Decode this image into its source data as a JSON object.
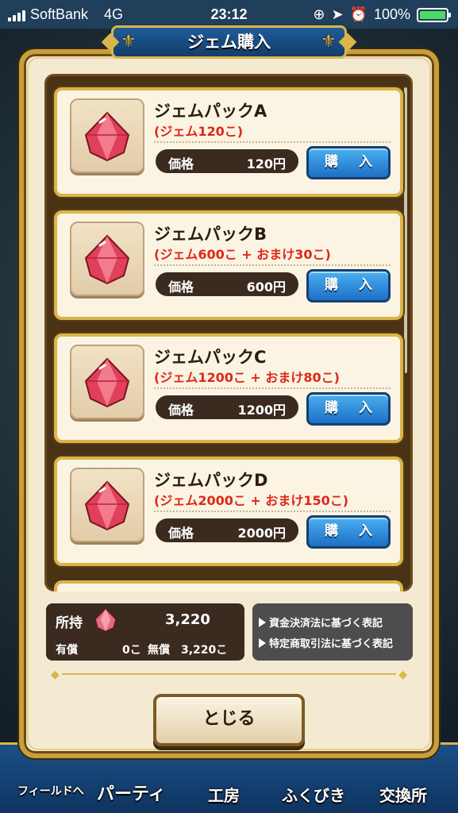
{
  "status": {
    "carrier": "SoftBank",
    "network": "4G",
    "time": "23:12",
    "battery": "100%"
  },
  "dialog": {
    "title": "ジェム購入"
  },
  "packs": [
    {
      "name": "ジェムパックA",
      "bonus": "(ジェム120こ)",
      "price_label": "価格",
      "price": "120円",
      "buy_label": "購 入"
    },
    {
      "name": "ジェムパックB",
      "bonus": "(ジェム600こ + おまけ30こ)",
      "price_label": "価格",
      "price": "600円",
      "buy_label": "購 入"
    },
    {
      "name": "ジェムパックC",
      "bonus": "(ジェム1200こ + おまけ80こ)",
      "price_label": "価格",
      "price": "1200円",
      "buy_label": "購 入"
    },
    {
      "name": "ジェムパックD",
      "bonus": "(ジェム2000こ + おまけ150こ)",
      "price_label": "価格",
      "price": "2000円",
      "buy_label": "購 入"
    }
  ],
  "owned": {
    "label": "所持",
    "total": "3,220",
    "unit": "こ",
    "paid_label": "有償",
    "paid_value": "0こ",
    "free_label": "無償",
    "free_value": "3,220こ"
  },
  "legal": {
    "link1": "資金決済法に基づく表記",
    "link2": "特定商取引法に基づく表記"
  },
  "close_label": "とじる",
  "bottom_nav": {
    "field": "フィールドへ",
    "party": "パーティ",
    "kobo": "工房",
    "fukubiki": "ふくびき",
    "kokan": "交換所"
  },
  "colors": {
    "accent_gold": "#d9b54a",
    "bonus_red": "#e0271b",
    "buy_blue": "#1d6fc6"
  }
}
